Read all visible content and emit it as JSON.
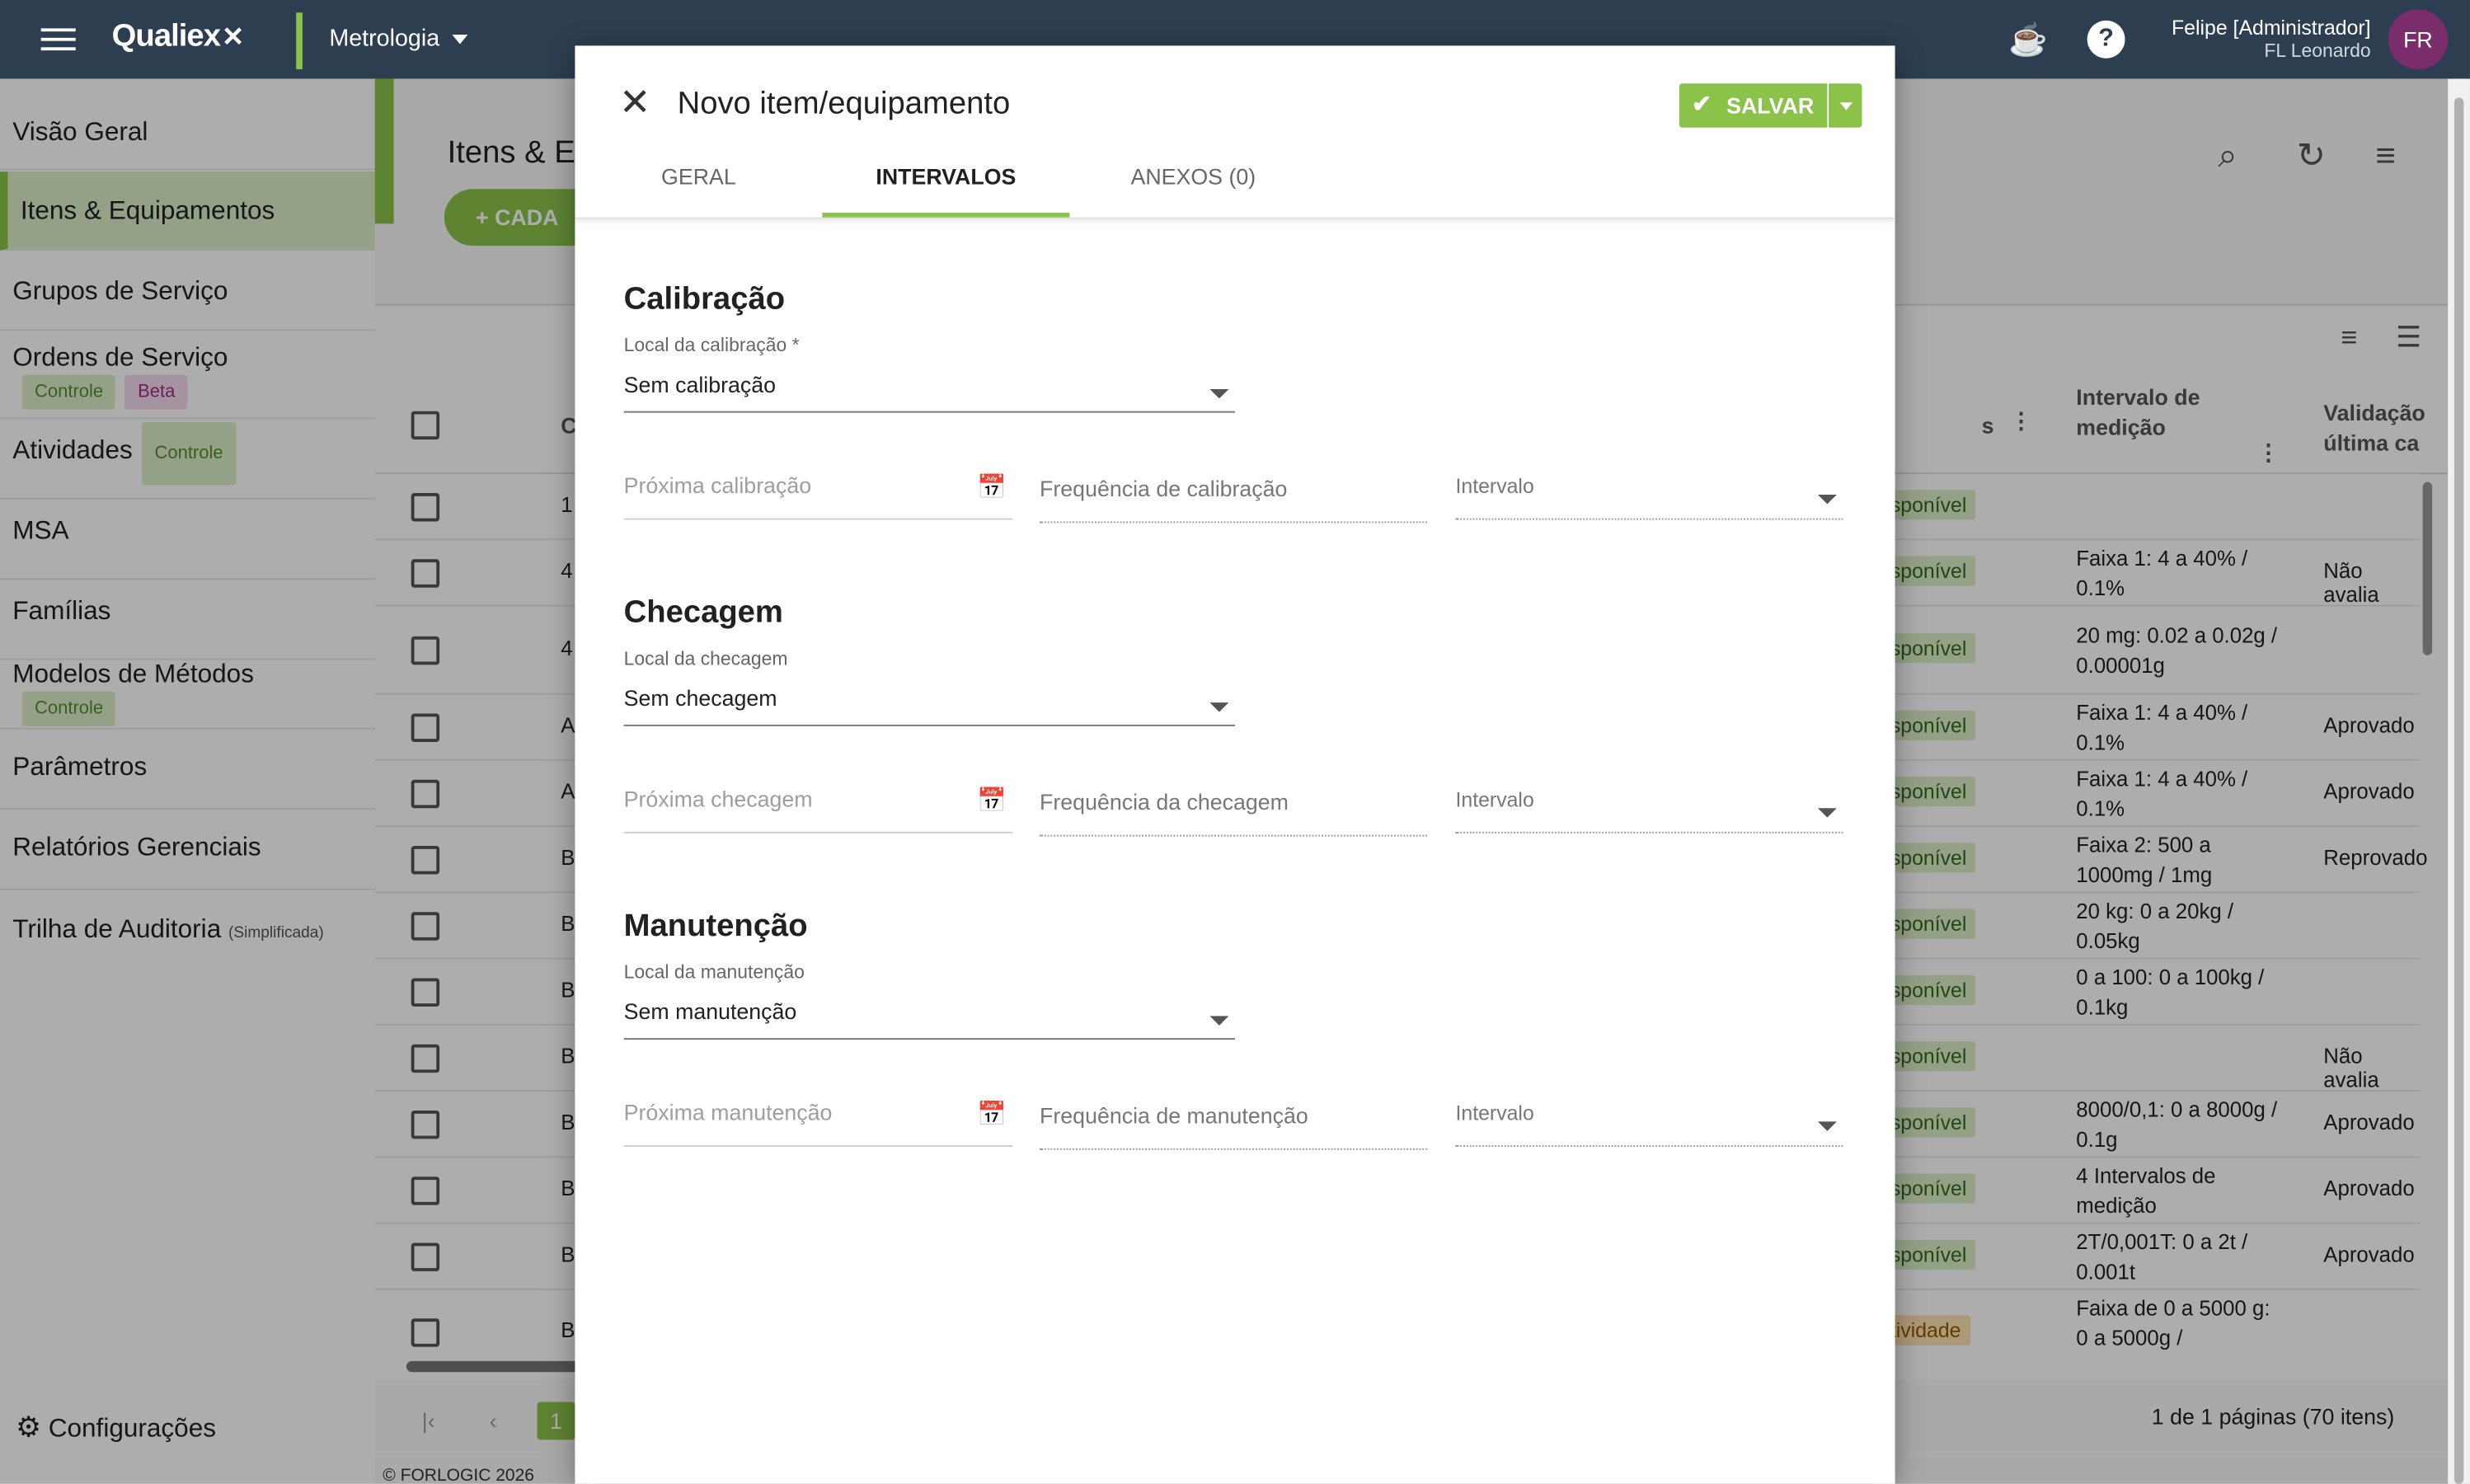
{
  "app": {
    "name": "Qualiex",
    "module": "Metrologia"
  },
  "user": {
    "name": "Felipe [Administrador]",
    "company": "FL Leonardo",
    "initials": "FR"
  },
  "sidebar": {
    "items": [
      {
        "label": "Visão Geral"
      },
      {
        "label": "Itens & Equipamentos"
      },
      {
        "label": "Grupos de Serviço"
      },
      {
        "label": "Ordens de Serviço",
        "badges": [
          "Controle",
          "Beta"
        ]
      },
      {
        "label": "Atividades",
        "badges": [
          "Controle"
        ]
      },
      {
        "label": "MSA"
      },
      {
        "label": "Famílias"
      },
      {
        "label": "Modelos de Métodos",
        "badges": [
          "Controle"
        ]
      },
      {
        "label": "Parâmetros"
      },
      {
        "label": "Relatórios Gerenciais"
      },
      {
        "label": "Trilha de Auditoria",
        "suffix": "(Simplificada)"
      }
    ],
    "settings": "Configurações"
  },
  "main": {
    "title": "Itens & E",
    "add_button": "CADA",
    "columns": {
      "col_c": "C",
      "interval": "Intervalo de medição",
      "validation": "Validação última ca",
      "status_dots": "s"
    },
    "rows": [
      {
        "a": "1",
        "status": "sponível",
        "interval": "",
        "validation": ""
      },
      {
        "a": "4",
        "status": "sponível",
        "interval": "Faixa 1: 4 a 40% / 0.1%",
        "validation": "Não avalia"
      },
      {
        "a": "4",
        "status": "sponível",
        "interval": "20 mg: 0.02 a 0.02g / 0.00001g",
        "validation": ""
      },
      {
        "a": "A",
        "status": "sponível",
        "interval": "Faixa 1: 4 a 40% / 0.1%",
        "validation": "Aprovado"
      },
      {
        "a": "A",
        "status": "sponível",
        "interval": "Faixa 1: 4 a 40% / 0.1%",
        "validation": "Aprovado"
      },
      {
        "a": "B",
        "status": "sponível",
        "interval": "Faixa 2: 500 a 1000mg / 1mg",
        "validation": "Reprovado"
      },
      {
        "a": "B",
        "status": "sponível",
        "interval": "20 kg: 0 a 20kg / 0.05kg",
        "validation": ""
      },
      {
        "a": "B",
        "status": "sponível",
        "interval": "0 a 100: 0 a 100kg / 0.1kg",
        "validation": ""
      },
      {
        "a": "B",
        "status": "sponível",
        "interval": "",
        "validation": "Não avalia"
      },
      {
        "a": "B",
        "status": "sponível",
        "interval": "8000/0,1: 0 a 8000g / 0.1g",
        "validation": "Aprovado"
      },
      {
        "a": "B",
        "status": "sponível",
        "interval": "4 Intervalos de medição",
        "validation": "Aprovado"
      },
      {
        "a": "B",
        "status": "sponível",
        "interval": "2T/0,001T: 0 a 2t / 0.001t",
        "validation": "Aprovado"
      },
      {
        "a": "B",
        "status": "tividade",
        "interval": "Faixa de 0 a 5000 g: 0 a 5000g /",
        "validation": ""
      }
    ],
    "pager": {
      "current": "1",
      "summary": "1 de 1 páginas (70 itens)"
    },
    "copyright": "© FORLOGIC 2026"
  },
  "modal": {
    "title": "Novo item/equipamento",
    "save_label": "SALVAR",
    "tabs": [
      "GERAL",
      "INTERVALOS",
      "ANEXOS (0)"
    ],
    "sections": [
      {
        "title": "Calibração",
        "local_label": "Local da calibração *",
        "local_value": "Sem calibração",
        "next_placeholder": "Próxima calibração",
        "freq_placeholder": "Frequência de calibração",
        "interval_label": "Intervalo"
      },
      {
        "title": "Checagem",
        "local_label": "Local da checagem",
        "local_value": "Sem checagem",
        "next_placeholder": "Próxima checagem",
        "freq_placeholder": "Frequência da checagem",
        "interval_label": "Intervalo"
      },
      {
        "title": "Manutenção",
        "local_label": "Local da manutenção",
        "local_value": "Sem manutenção",
        "next_placeholder": "Próxima manutenção",
        "freq_placeholder": "Frequência de manutenção",
        "interval_label": "Intervalo"
      }
    ]
  },
  "colors": {
    "brand_bar": "#2c3e50",
    "accent": "#8bc34a",
    "avatar": "#7b2d6b"
  },
  "icons": [
    "menu-icon",
    "coffee-icon",
    "help-icon",
    "search-icon",
    "refresh-icon",
    "filter-icon",
    "calendar-icon",
    "close-icon",
    "check-icon",
    "gear-icon"
  ]
}
